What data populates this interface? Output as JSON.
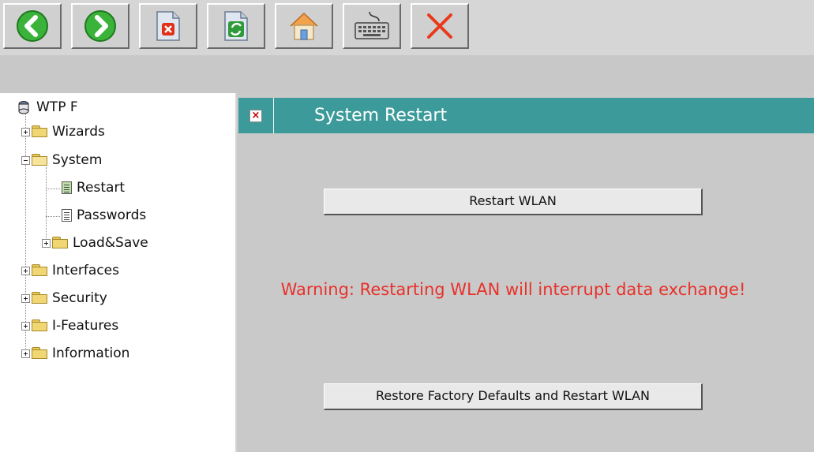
{
  "toolbar": {
    "buttons": [
      {
        "icon": "back-arrow-icon"
      },
      {
        "icon": "forward-arrow-icon"
      },
      {
        "icon": "stop-page-icon"
      },
      {
        "icon": "refresh-page-icon"
      },
      {
        "icon": "home-icon"
      },
      {
        "icon": "keyboard-icon"
      },
      {
        "icon": "close-x-icon"
      }
    ]
  },
  "tree": {
    "root": "WTP F",
    "items": [
      {
        "label": "Wizards"
      },
      {
        "label": "System"
      },
      {
        "label": "Restart"
      },
      {
        "label": "Passwords"
      },
      {
        "label": "Load&Save"
      },
      {
        "label": "Interfaces"
      },
      {
        "label": "Security"
      },
      {
        "label": "I-Features"
      },
      {
        "label": "Information"
      }
    ]
  },
  "content": {
    "title": "System Restart",
    "restart_button": "Restart WLAN",
    "warning": "Warning: Restarting WLAN will interrupt data exchange!",
    "factory_button": "Restore Factory Defaults and Restart WLAN"
  },
  "colors": {
    "header": "#3c9a9a",
    "warning": "#e8312a",
    "back_forward_green": "#3bb33b",
    "close_red": "#e83a1a"
  }
}
